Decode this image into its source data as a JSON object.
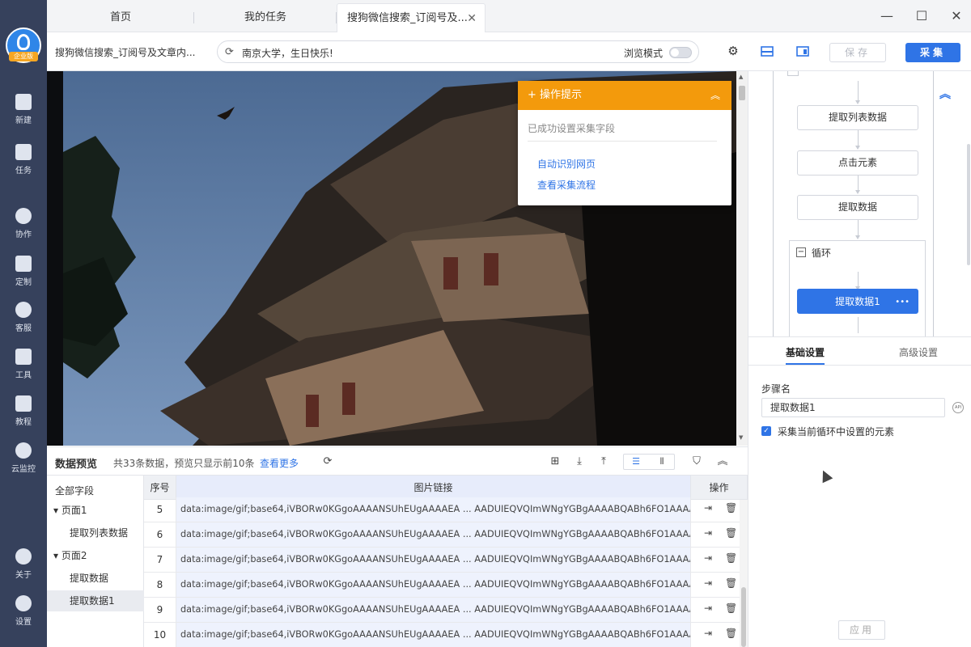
{
  "sidebar": {
    "logo_label": "企业版",
    "items": [
      {
        "label": "新建",
        "icon": "plus-icon"
      },
      {
        "label": "任务",
        "icon": "bookmark-icon"
      },
      {
        "label": "协作",
        "icon": "users-icon"
      },
      {
        "label": "定制",
        "icon": "heart-check-icon"
      },
      {
        "label": "客服",
        "icon": "headset-icon"
      },
      {
        "label": "工具",
        "icon": "toolbox-icon"
      },
      {
        "label": "教程",
        "icon": "graduation-cap-icon"
      },
      {
        "label": "云监控",
        "icon": "cloud-pulse-icon"
      },
      {
        "label": "关于",
        "icon": "info-icon"
      },
      {
        "label": "设置",
        "icon": "gear-icon"
      }
    ]
  },
  "tabs": [
    {
      "label": "首页"
    },
    {
      "label": "我的任务"
    },
    {
      "label": "搜狗微信搜索_订阅号及..."
    }
  ],
  "window_controls": {
    "minimize": "—",
    "maximize": "☐",
    "close": "✕"
  },
  "toolbar": {
    "page_title": "搜狗微信搜索_订阅号及文章内...",
    "address": "南京大学，生日快乐!",
    "browse_mode_label": "浏览模式",
    "browse_mode_on": false,
    "save_label": "保存",
    "collect_label": "采集"
  },
  "tips": {
    "title": "操作提示",
    "message": "已成功设置采集字段",
    "links": [
      "自动识别网页",
      "查看采集流程"
    ]
  },
  "preview": {
    "title": "数据预览",
    "count_text": "共33条数据，预览只显示前10条",
    "more_link": "查看更多"
  },
  "fields": {
    "all": "全部字段",
    "groups": [
      {
        "label": "页面1",
        "items": [
          "提取列表数据"
        ]
      },
      {
        "label": "页面2",
        "items": [
          "提取数据",
          "提取数据1"
        ]
      }
    ]
  },
  "table": {
    "headers": [
      "序号",
      "图片链接",
      "操作"
    ],
    "rows": [
      {
        "no": "5",
        "url": "data:image/gif;base64,iVBORw0KGgoAAAANSUhEUgAAAAEA ... AADUIEQVQImWNgYGBgAAAABQABh6FO1AAAAAB..."
      },
      {
        "no": "6",
        "url": "data:image/gif;base64,iVBORw0KGgoAAAANSUhEUgAAAAEA ... AADUIEQVQImWNgYGBgAAAABQABh6FO1AAAAAB..."
      },
      {
        "no": "7",
        "url": "data:image/gif;base64,iVBORw0KGgoAAAANSUhEUgAAAAEA ... AADUIEQVQImWNgYGBgAAAABQABh6FO1AAAAAB..."
      },
      {
        "no": "8",
        "url": "data:image/gif;base64,iVBORw0KGgoAAAANSUhEUgAAAAEA ... AADUIEQVQImWNgYGBgAAAABQABh6FO1AAAAAB..."
      },
      {
        "no": "9",
        "url": "data:image/gif;base64,iVBORw0KGgoAAAANSUhEUgAAAAEA ... AADUIEQVQImWNgYGBgAAAABQABh6FO1AAAAAB..."
      },
      {
        "no": "10",
        "url": "data:image/gif;base64,iVBORw0KGgoAAAANSUhEUgAAAAEA ... AADUIEQVQImWNgYGBgAAAABQABh6FO1AAAAAB..."
      }
    ]
  },
  "flow": {
    "steps": [
      "提取列表数据",
      "点击元素",
      "提取数据"
    ],
    "loop_label": "循环",
    "active_step": "提取数据1",
    "active_more": "•••"
  },
  "settings": {
    "tabs": [
      "基础设置",
      "高级设置"
    ],
    "step_name_label": "步骤名",
    "step_name_value": "提取数据1",
    "api_badge": "API",
    "checkbox_label": "采集当前循环中设置的元素",
    "checkbox_checked": true,
    "apply_label": "应用"
  },
  "colors": {
    "sidebar": "#36415c",
    "accent": "#2f74e6",
    "tips_header": "#f39a0c"
  }
}
